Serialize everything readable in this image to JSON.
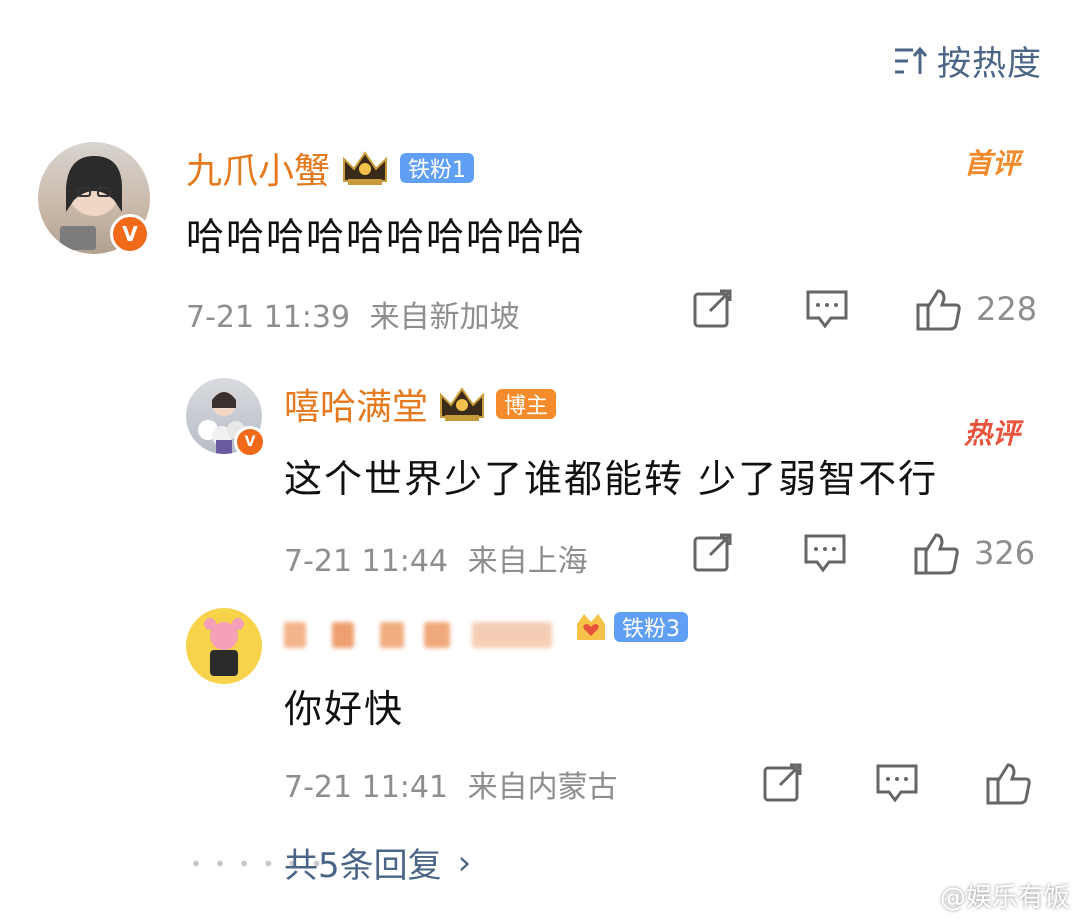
{
  "sort": {
    "label": "按热度",
    "icon": "sort-icon"
  },
  "comments": [
    {
      "username": "九爪小蟹",
      "badge_label": "铁粉1",
      "tag": "首评",
      "text": "哈哈哈哈哈哈哈哈哈哈",
      "time": "7-21 11:39",
      "location": "来自新加坡",
      "likes": "228"
    },
    {
      "username": "嘻哈满堂",
      "badge_label": "博主",
      "tag": "热评",
      "text": "这个世界少了谁都能转 少了弱智不行",
      "time": "7-21 11:44",
      "location": "来自上海",
      "likes": "326"
    },
    {
      "username": "",
      "badge_label": "铁粉3",
      "text": "你好快",
      "time": "7-21 11:41",
      "location": "来自内蒙古",
      "likes": ""
    }
  ],
  "replies": {
    "label": "共5条回复",
    "arrow": "›"
  },
  "watermark": {
    "text": "@娱乐有饭"
  },
  "colors": {
    "accent": "#4b6587",
    "username": "#e4791d",
    "hot": "#e8533e"
  }
}
